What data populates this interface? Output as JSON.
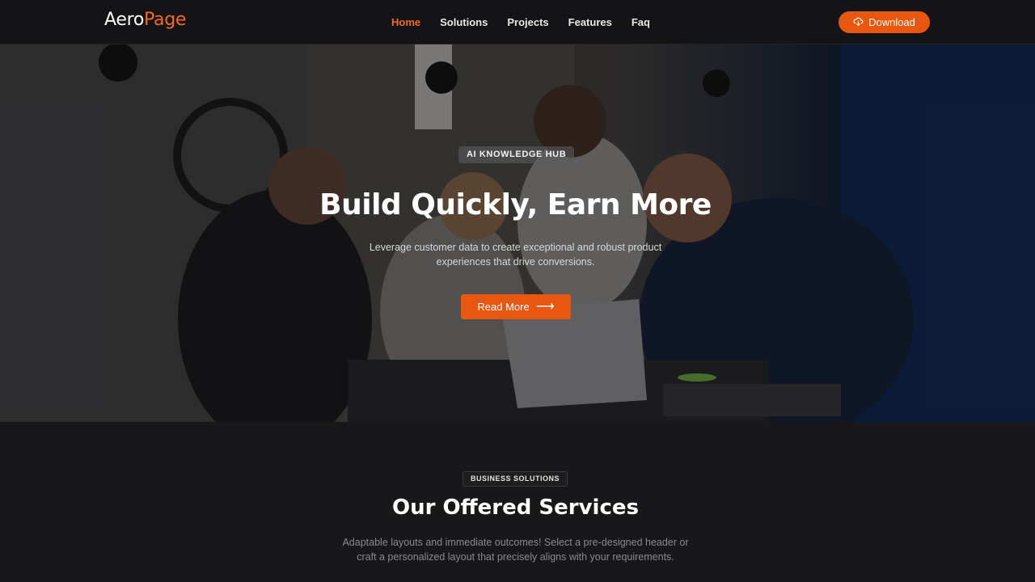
{
  "header": {
    "logo_part1": "Aero",
    "logo_part2": "Page",
    "nav": [
      {
        "label": "Home",
        "active": true
      },
      {
        "label": "Solutions",
        "active": false
      },
      {
        "label": "Projects",
        "active": false
      },
      {
        "label": "Features",
        "active": false
      },
      {
        "label": "Faq",
        "active": false
      }
    ],
    "download_label": "Download",
    "download_icon": "cloud-download-icon"
  },
  "hero": {
    "badge": "AI KNOWLEDGE HUB",
    "title": "Build Quickly, Earn More",
    "subtitle": "Leverage customer data to create exceptional and robust product experiences that drive conversions.",
    "cta_label": "Read More",
    "cta_icon": "arrow-right-icon"
  },
  "services": {
    "badge": "BUSINESS SOLUTIONS",
    "title": "Our Offered Services",
    "description": "Adaptable layouts and immediate outcomes! Select a pre-designed header or craft a personalized layout that precisely aligns with your requirements."
  },
  "colors": {
    "accent": "#e8570f",
    "background": "#18181b",
    "header_bg": "#141416"
  }
}
